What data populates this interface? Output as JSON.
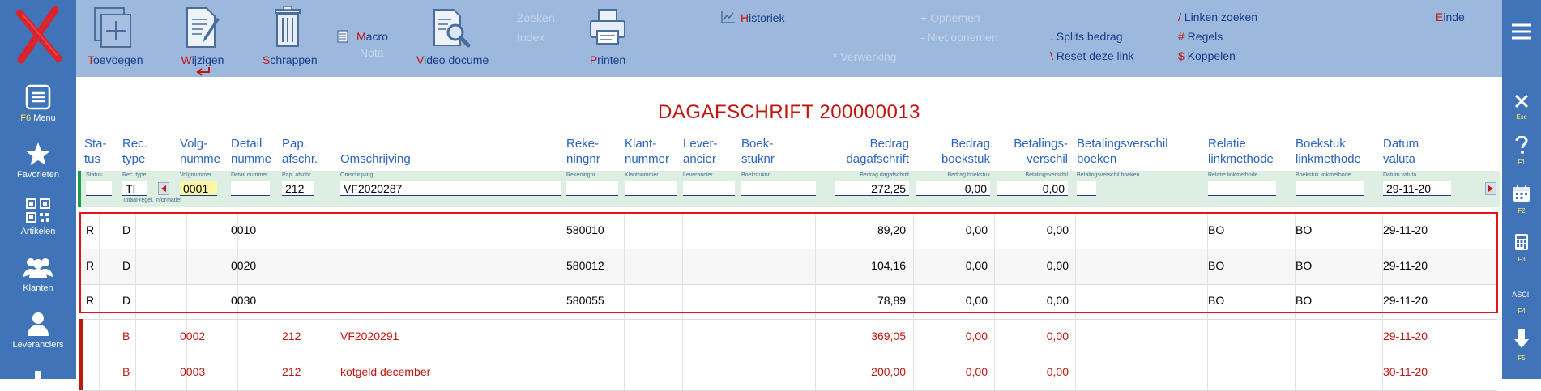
{
  "sidebar": {
    "menu_key": "F6",
    "menu_label": "Menu",
    "favorites": "Favorieten",
    "articles": "Artikelen",
    "clients": "Klanten",
    "suppliers": "Leveranciers"
  },
  "rightbar": {
    "esc": "Esc",
    "f1": "F1",
    "f2": "F2",
    "f3": "F3",
    "ascii": "ASCII",
    "f4": "F4",
    "f5": "F5"
  },
  "toolbar": {
    "add_hot": "T",
    "add_rest": "oevoegen",
    "edit_hot": "W",
    "edit_rest": "ijzigen",
    "delete_hot": "S",
    "delete_rest": "chrappen",
    "macro_hot": "M",
    "macro_rest": "acro",
    "nota": "Nota",
    "video_hot": "V",
    "video_rest": "ideo docume",
    "search": "Zoeken",
    "index": "Index",
    "print_hot": "P",
    "print_rest": "rinten",
    "history_hot": "H",
    "history_rest": "istoriek",
    "processing": "* Verwerking",
    "include": "+ Opnemen",
    "exclude": "- Niet opnemen",
    "split_hot": ".",
    "split_rest": " Splits bedrag",
    "reset_hot": "\\",
    "reset_rest": " Reset deze link",
    "link_search_hot": "/",
    "link_search_rest": " Linken zoeken",
    "rules_hot": "#",
    "rules_rest": " Regels",
    "couple_hot": "$",
    "couple_rest": " Koppelen",
    "end_hot": "E",
    "end_rest": "inde"
  },
  "title": "DAGAFSCHRIFT 200000013",
  "columns": [
    {
      "l1": "Sta-",
      "l2": "tus"
    },
    {
      "l1": "Rec.",
      "l2": "type"
    },
    {
      "l1": "Volg-",
      "l2": "numme"
    },
    {
      "l1": "Detail",
      "l2": "numme"
    },
    {
      "l1": "Pap.",
      "l2": "afschr."
    },
    {
      "l1": "",
      "l2": "Omschrijving"
    },
    {
      "l1": "Reke-",
      "l2": "ningnr"
    },
    {
      "l1": "Klant-",
      "l2": "nummer"
    },
    {
      "l1": "Lever-",
      "l2": "ancier"
    },
    {
      "l1": "Boek-",
      "l2": "stuknr"
    },
    {
      "l1": "Bedrag",
      "l2": "dagafschrift"
    },
    {
      "l1": "Bedrag",
      "l2": "boekstuk"
    },
    {
      "l1": "Betalings-",
      "l2": "verschil"
    },
    {
      "l1": "Betalingsverschil",
      "l2": "boeken"
    },
    {
      "l1": "Relatie",
      "l2": "linkmethode"
    },
    {
      "l1": "Boekstuk",
      "l2": "linkmethode"
    },
    {
      "l1": "Datum",
      "l2": "valuta"
    }
  ],
  "input_row": {
    "labels": [
      "Status",
      "Rec. type",
      "Volgnummer",
      "Detail nummer",
      "Pap. afschr.",
      "Omschrijving",
      "Rekeningnr",
      "Klantnummer",
      "Leverancier",
      "Boekstuknr",
      "Bedrag dagafschrift",
      "Bedrag boekstuk",
      "Betalingsverschil",
      "Betalingsverschil boeken",
      "Relatie linkmethode",
      "Boekstuk linkmethode",
      "Datum valuta"
    ],
    "status": "",
    "rec_type": "TI",
    "rec_type_hint": "Totaal-regel, informatief",
    "volgnummer": "0001",
    "detail": "",
    "pap": "212",
    "omschrijving": "VF2020287",
    "rekeningnr": "",
    "klantnummer": "",
    "leverancier": "",
    "boekstuknr": "",
    "bedrag_dagafschrift": "272,25",
    "bedrag_boekstuk": "0,00",
    "betalingsverschil": "0,00",
    "verschil_boeken": "",
    "relatie_link": "",
    "boekstuk_link": "",
    "datum": "29-11-20"
  },
  "rows": [
    {
      "status": "R",
      "type": "D",
      "volg": "",
      "detail": "0010",
      "pap": "",
      "oms": "",
      "rek": "580010",
      "bedrag_dag": "89,20",
      "bedrag_bk": "0,00",
      "verschil": "0,00",
      "rel_link": "BO",
      "bk_link": "BO",
      "datum": "29-11-20"
    },
    {
      "status": "R",
      "type": "D",
      "volg": "",
      "detail": "0020",
      "pap": "",
      "oms": "",
      "rek": "580012",
      "bedrag_dag": "104,16",
      "bedrag_bk": "0,00",
      "verschil": "0,00",
      "rel_link": "BO",
      "bk_link": "BO",
      "datum": "29-11-20"
    },
    {
      "status": "R",
      "type": "D",
      "volg": "",
      "detail": "0030",
      "pap": "",
      "oms": "",
      "rek": "580055",
      "bedrag_dag": "78,89",
      "bedrag_bk": "0,00",
      "verschil": "0,00",
      "rel_link": "BO",
      "bk_link": "BO",
      "datum": "29-11-20"
    },
    {
      "status": "",
      "type": "B",
      "volg": "0002",
      "detail": "",
      "pap": "212",
      "oms": "VF2020291",
      "rek": "",
      "bedrag_dag": "369,05",
      "bedrag_bk": "0,00",
      "verschil": "0,00",
      "rel_link": "",
      "bk_link": "",
      "datum": "29-11-20"
    },
    {
      "status": "",
      "type": "B",
      "volg": "0003",
      "detail": "",
      "pap": "212",
      "oms": "kotgeld december",
      "rek": "",
      "bedrag_dag": "200,00",
      "bedrag_bk": "0,00",
      "verschil": "0,00",
      "rel_link": "",
      "bk_link": "",
      "datum": "30-11-20"
    }
  ],
  "colors": {
    "sidebar": "#3f74b8",
    "toolbar": "#9cb8dc",
    "accent_red": "#c0160f",
    "header_blue": "#2a64c0"
  }
}
